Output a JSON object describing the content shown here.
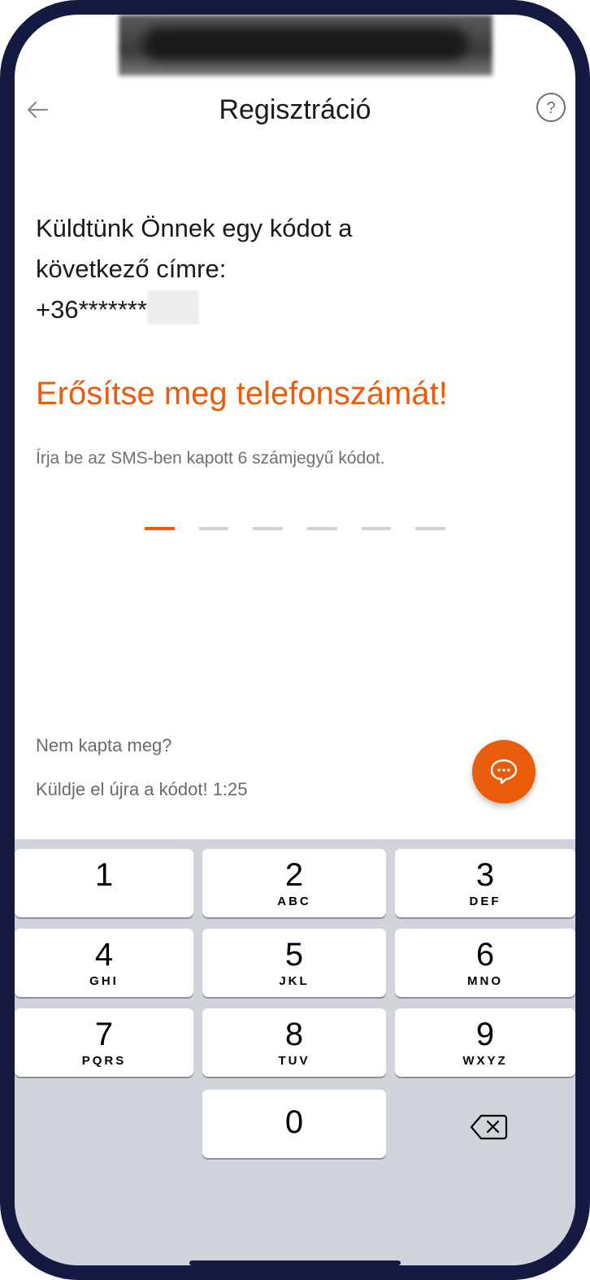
{
  "header": {
    "title": "Regisztráció",
    "back_icon": "arrow-left-icon",
    "help_icon": "question-circle-icon"
  },
  "message": {
    "line1": "Küldtünk Önnek egy kódot a",
    "line2": "következő címre:",
    "phone_masked": "+36*******"
  },
  "headline": "Erősítse meg telefonszámát!",
  "instruction": "Írja be az SMS-ben kapott 6 számjegyű kódot.",
  "code": {
    "length": 6,
    "active_index": 0
  },
  "resend": {
    "question": "Nem kapta meg?",
    "action": "Küldje el újra a kódot! 1:25"
  },
  "chat_button": {
    "icon": "chat-bubble-icon"
  },
  "keypad": {
    "keys": [
      {
        "num": "1",
        "letters": ""
      },
      {
        "num": "2",
        "letters": "ABC"
      },
      {
        "num": "3",
        "letters": "DEF"
      },
      {
        "num": "4",
        "letters": "GHI"
      },
      {
        "num": "5",
        "letters": "JKL"
      },
      {
        "num": "6",
        "letters": "MNO"
      },
      {
        "num": "7",
        "letters": "PQRS"
      },
      {
        "num": "8",
        "letters": "TUV"
      },
      {
        "num": "9",
        "letters": "WXYZ"
      },
      {
        "num": "0",
        "letters": ""
      }
    ],
    "delete_icon": "backspace-icon"
  },
  "colors": {
    "accent": "#ea5b0c",
    "frame": "#141a42",
    "keyboard_bg": "#d1d4da"
  }
}
